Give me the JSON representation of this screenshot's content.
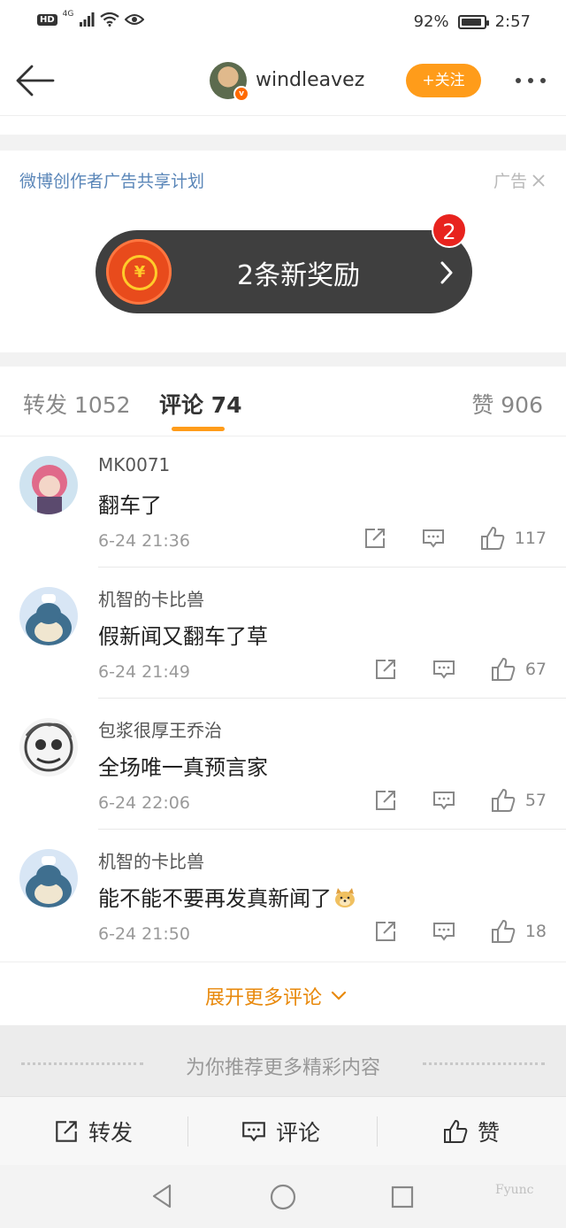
{
  "status_bar": {
    "hd": "HD",
    "network": "4G",
    "battery": "92%",
    "battery_level": 0.92,
    "time": "2:57"
  },
  "nav": {
    "username": "windleavez",
    "verified_badge": "v",
    "follow_label": "+关注"
  },
  "ad": {
    "title": "微博创作者广告共享计划",
    "tag": "广告",
    "reward_text": "2条新奖励",
    "reward_badge": "2",
    "coin_symbol": "¥"
  },
  "tabs": [
    {
      "label": "转发 1052"
    },
    {
      "label": "评论 74"
    },
    {
      "label": "赞 906"
    }
  ],
  "comments": [
    {
      "name": "MK0071",
      "text": "翻车了",
      "time": "6-24 21:36",
      "likes": "117"
    },
    {
      "name": "机智的卡比兽",
      "text": "假新闻又翻车了草",
      "time": "6-24 21:49",
      "likes": "67"
    },
    {
      "name": "包浆很厚王乔治",
      "text": "全场唯一真预言家",
      "time": "6-24 22:06",
      "likes": "57"
    },
    {
      "name": "机智的卡比兽",
      "text": "能不能不要再发真新闻了",
      "time": "6-24 21:50",
      "likes": "18"
    }
  ],
  "expand_label": "展开更多评论",
  "recommend_label": "为你推荐更多精彩内容",
  "bottom_bar": {
    "repost": "转发",
    "comment": "评论",
    "like": "赞"
  },
  "watermark": "Fyunc"
}
